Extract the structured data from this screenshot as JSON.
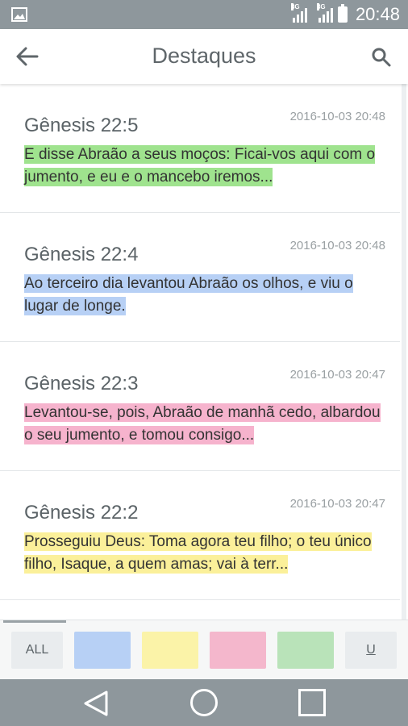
{
  "status": {
    "network1": "3G",
    "network2": "3G",
    "time": "20:48"
  },
  "appbar": {
    "title": "Destaques",
    "back_icon": "arrow-left-icon",
    "search_icon": "search-icon"
  },
  "highlights": [
    {
      "reference": "Gênesis 22:5",
      "timestamp": "2016-10-03 20:48",
      "text": "E disse Abraão a seus moços: Ficai-vos aqui com o jumento, e eu e o mancebo iremos...",
      "color": "#9fe38e"
    },
    {
      "reference": "Gênesis 22:4",
      "timestamp": "2016-10-03 20:48",
      "text": "Ao terceiro dia levantou Abraão os olhos, e viu o lugar de longe.",
      "color": "#b7d0f5"
    },
    {
      "reference": "Gênesis 22:3",
      "timestamp": "2016-10-03 20:47",
      "text": "Levantou-se, pois, Abraão de manhã cedo, albardou o seu jumento, e tomou consigo...",
      "color": "#f6b3cd"
    },
    {
      "reference": "Gênesis 22:2",
      "timestamp": "2016-10-03 20:47",
      "text": "Prosseguiu Deus: Toma agora teu filho; o teu único filho, Isaque, a quem amas; vai à terr...",
      "color": "#fbf09a"
    }
  ],
  "filters": {
    "all_label": "ALL",
    "underline_label": "U",
    "colors": {
      "blue": "#b7d0f5",
      "yellow": "#fbf3a8",
      "pink": "#f4b7cc",
      "green": "#b9e3b9"
    }
  },
  "colors": {
    "statusbar": "#8e979c",
    "navbar": "#8e979c",
    "title": "#5f666a"
  }
}
